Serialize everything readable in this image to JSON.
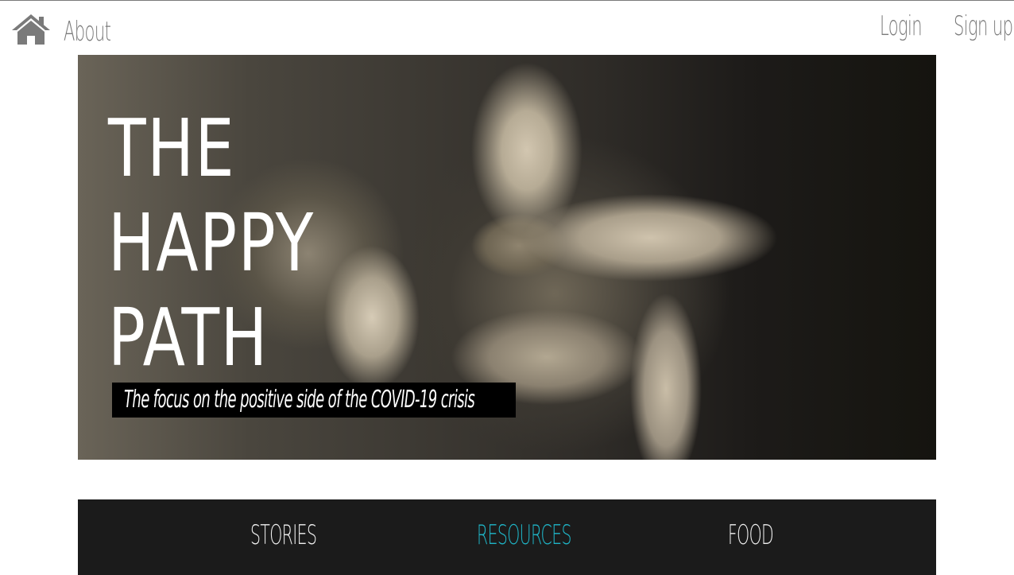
{
  "nav": {
    "home_icon": "home-icon",
    "about_label": "About",
    "login_label": "Login",
    "signup_label": "Sign up"
  },
  "hero": {
    "title_lines": [
      "THE",
      "HAPPY",
      "PATH"
    ],
    "caption": "The focus on the positive side of the COVID-19 crisis"
  },
  "categories": {
    "items": [
      {
        "label": "STORIES"
      },
      {
        "label": "RESOURCES"
      },
      {
        "label": "FOOD"
      }
    ],
    "active_color": "#1fb6c8"
  },
  "colors": {
    "nav_text": "#7a7a7a",
    "bar_background": "#1b1b1b"
  }
}
